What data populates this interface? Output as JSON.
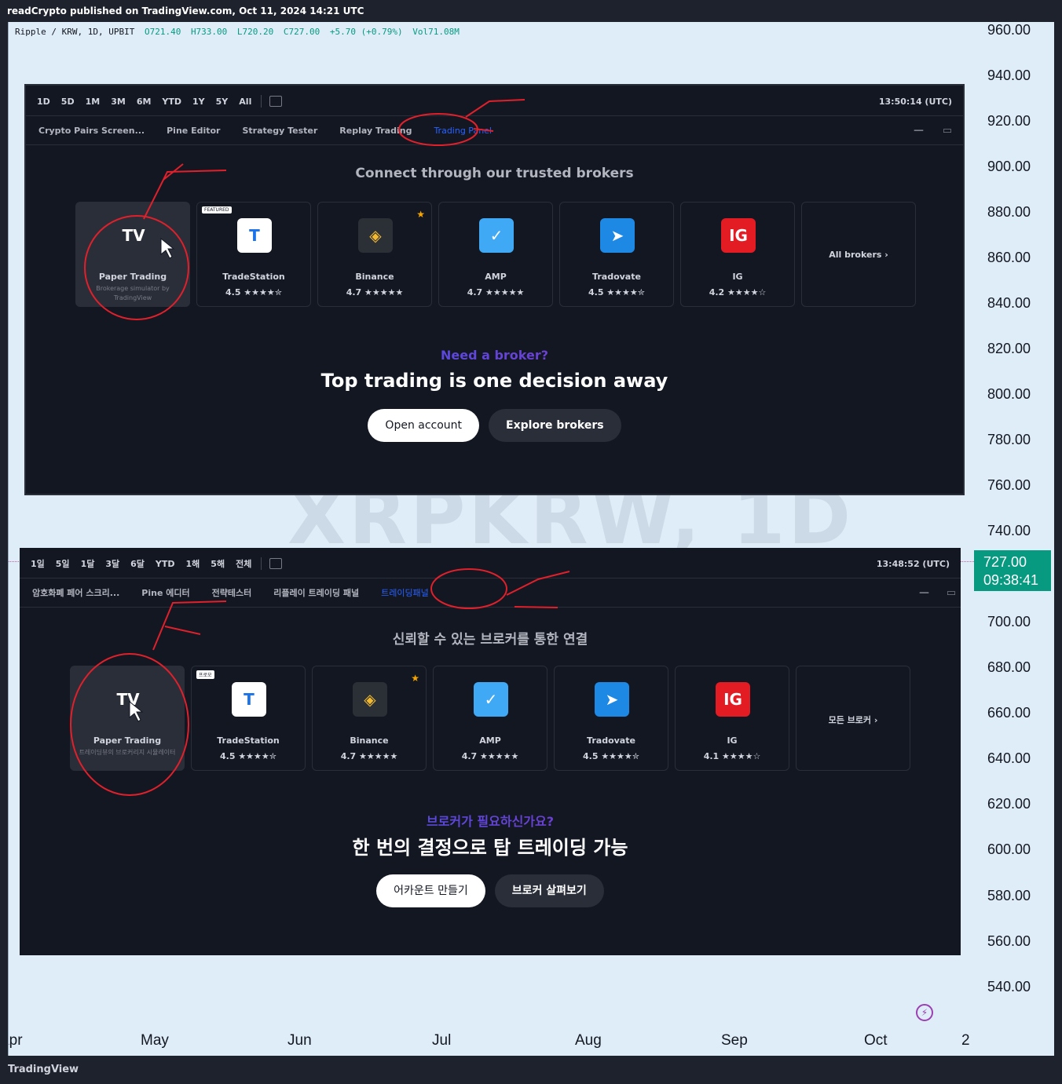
{
  "publish_line": "readCrypto published on TradingView.com, Oct 11, 2024 14:21 UTC",
  "legend": {
    "symbol": "Ripple / KRW, 1D, UPBIT",
    "open": "O721.40",
    "high": "H733.00",
    "low": "L720.20",
    "close": "C727.00",
    "change": "+5.70 (+0.79%)",
    "volume": "Vol71.08M"
  },
  "watermark": "XRPKRW, 1D",
  "price_axis": [
    "960.00",
    "940.00",
    "920.00",
    "900.00",
    "880.00",
    "860.00",
    "840.00",
    "820.00",
    "800.00",
    "780.00",
    "760.00",
    "740.00",
    "700.00",
    "680.00",
    "660.00",
    "640.00",
    "620.00",
    "600.00",
    "580.00",
    "560.00",
    "540.00"
  ],
  "time_axis": [
    "Apr",
    "May",
    "Jun",
    "Jul",
    "Aug",
    "Sep",
    "Oct",
    "2"
  ],
  "current_price": {
    "price": "727.00",
    "countdown": "09:38:41",
    "color": "#089981"
  },
  "panel_en": {
    "timeframes": [
      "1D",
      "5D",
      "1M",
      "3M",
      "6M",
      "YTD",
      "1Y",
      "5Y",
      "All"
    ],
    "time": "13:50:14 (UTC)",
    "tabs": [
      "Crypto Pairs Screen...",
      "Pine Editor",
      "Strategy Tester",
      "Replay Trading",
      "Trading Panel"
    ],
    "heading": "Connect through our trusted brokers",
    "cards": [
      {
        "name": "Paper Trading",
        "sub": "Brokerage simulator by TradingView"
      },
      {
        "name": "TradeStation",
        "rating": "4.5 ★★★★✮",
        "badge": "FEATURED"
      },
      {
        "name": "Binance",
        "rating": "4.7 ★★★★★"
      },
      {
        "name": "AMP",
        "rating": "4.7 ★★★★★"
      },
      {
        "name": "Tradovate",
        "rating": "4.5 ★★★★✮"
      },
      {
        "name": "IG",
        "rating": "4.2 ★★★★☆"
      }
    ],
    "all_brokers": "All brokers ›",
    "need": "Need a broker?",
    "big": "Top trading is one decision away",
    "btn_open": "Open account",
    "btn_explore": "Explore brokers"
  },
  "panel_ko": {
    "timeframes": [
      "1일",
      "5일",
      "1달",
      "3달",
      "6달",
      "YTD",
      "1해",
      "5해",
      "전체"
    ],
    "time": "13:48:52 (UTC)",
    "tabs": [
      "암호화폐 페어 스크리...",
      "Pine 에디터",
      "전략테스터",
      "리플레이 트레이딩 패널",
      "트레이딩패널"
    ],
    "heading": "신뢰할 수 있는 브로커를 통한 연결",
    "cards": [
      {
        "name": "Paper Trading",
        "sub": "트레이딩뷰의 브로커리지 시뮬레이터"
      },
      {
        "name": "TradeStation",
        "rating": "4.5 ★★★★✮",
        "badge": "프로모"
      },
      {
        "name": "Binance",
        "rating": "4.7 ★★★★★"
      },
      {
        "name": "AMP",
        "rating": "4.7 ★★★★★"
      },
      {
        "name": "Tradovate",
        "rating": "4.5 ★★★★✮"
      },
      {
        "name": "IG",
        "rating": "4.1 ★★★★☆"
      }
    ],
    "all_brokers": "모든 브로커 ›",
    "need": "브로커가 필요하신가요?",
    "big": "한 번의 결정으로 탑 트레이딩 가능",
    "btn_open": "어카운트 만들기",
    "btn_explore": "브로커 살펴보기"
  },
  "footer": "TradingView",
  "colors": {
    "tradestation": "#1a73e8",
    "binance": "#f3ba2f",
    "amp": "#3fa9f5",
    "tradovate": "#1e88e5",
    "ig": "#e31b23"
  }
}
